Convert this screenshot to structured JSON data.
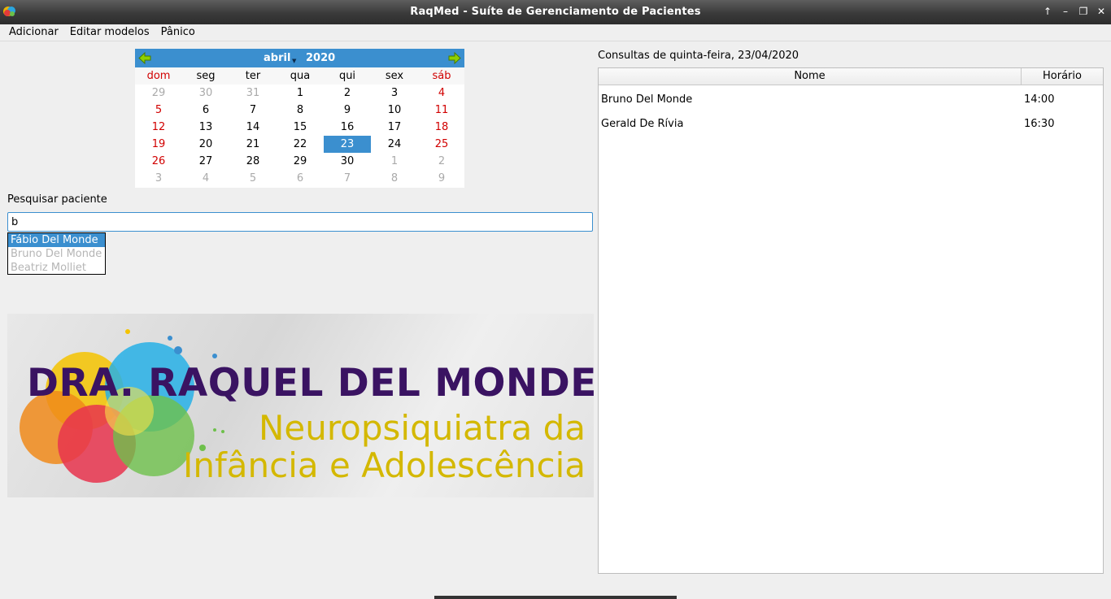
{
  "window": {
    "title": "RaqMed - Suíte de Gerenciamento de Pacientes",
    "buttons": [
      "↑",
      "–",
      "❐",
      "✕"
    ]
  },
  "menu": [
    "Adicionar",
    "Editar modelos",
    "Pânico"
  ],
  "calendar": {
    "month": "abril",
    "year": "2020",
    "weekdays": [
      "dom",
      "seg",
      "ter",
      "qua",
      "qui",
      "sex",
      "sáb"
    ],
    "weeks": [
      [
        {
          "d": "29",
          "s": "muted"
        },
        {
          "d": "30",
          "s": "muted"
        },
        {
          "d": "31",
          "s": "muted"
        },
        {
          "d": "1",
          "s": ""
        },
        {
          "d": "2",
          "s": ""
        },
        {
          "d": "3",
          "s": ""
        },
        {
          "d": "4",
          "s": "red"
        }
      ],
      [
        {
          "d": "5",
          "s": "red"
        },
        {
          "d": "6",
          "s": ""
        },
        {
          "d": "7",
          "s": ""
        },
        {
          "d": "8",
          "s": ""
        },
        {
          "d": "9",
          "s": ""
        },
        {
          "d": "10",
          "s": ""
        },
        {
          "d": "11",
          "s": "red"
        }
      ],
      [
        {
          "d": "12",
          "s": "red"
        },
        {
          "d": "13",
          "s": ""
        },
        {
          "d": "14",
          "s": ""
        },
        {
          "d": "15",
          "s": ""
        },
        {
          "d": "16",
          "s": ""
        },
        {
          "d": "17",
          "s": ""
        },
        {
          "d": "18",
          "s": "red"
        }
      ],
      [
        {
          "d": "19",
          "s": "red"
        },
        {
          "d": "20",
          "s": ""
        },
        {
          "d": "21",
          "s": ""
        },
        {
          "d": "22",
          "s": ""
        },
        {
          "d": "23",
          "s": "sel"
        },
        {
          "d": "24",
          "s": ""
        },
        {
          "d": "25",
          "s": "red"
        }
      ],
      [
        {
          "d": "26",
          "s": "red"
        },
        {
          "d": "27",
          "s": ""
        },
        {
          "d": "28",
          "s": ""
        },
        {
          "d": "29",
          "s": ""
        },
        {
          "d": "30",
          "s": ""
        },
        {
          "d": "1",
          "s": "muted"
        },
        {
          "d": "2",
          "s": "muted"
        }
      ],
      [
        {
          "d": "3",
          "s": "muted"
        },
        {
          "d": "4",
          "s": "muted"
        },
        {
          "d": "5",
          "s": "muted"
        },
        {
          "d": "6",
          "s": "muted"
        },
        {
          "d": "7",
          "s": "muted"
        },
        {
          "d": "8",
          "s": "muted"
        },
        {
          "d": "9",
          "s": "muted"
        }
      ]
    ]
  },
  "search": {
    "label": "Pesquisar paciente",
    "value": "b",
    "suggestions": [
      "Fábio Del Monde",
      "Bruno Del Monde",
      "Beatriz Molliet"
    ]
  },
  "banner": {
    "name": "DRA. RAQUEL DEL MONDE",
    "line1": "Neuropsiquiatra da",
    "line2": "Infância e Adolescência"
  },
  "appointments": {
    "label": "Consultas de quinta-feira, 23/04/2020",
    "columns": [
      "Nome",
      "Horário"
    ],
    "rows": [
      {
        "nome": "Bruno Del Monde",
        "horario": "14:00"
      },
      {
        "nome": "Gerald De Rívia",
        "horario": "16:30"
      }
    ]
  },
  "colors": {
    "accent": "#3b8fcf",
    "weekend": "#d10000",
    "bannerName": "#3a1362",
    "bannerSub": "#d4b800"
  }
}
